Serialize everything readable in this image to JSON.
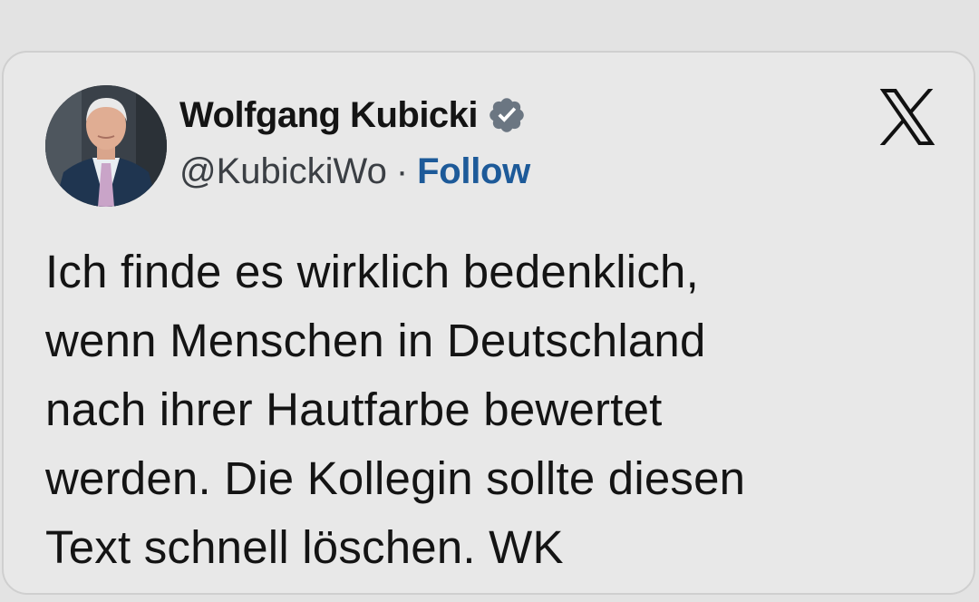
{
  "tweet": {
    "author": {
      "display_name": "Wolfgang Kubicki",
      "handle": "@KubickiWo",
      "separator": "·",
      "verified_badge_icon": "verified-badge-icon",
      "avatar_icon": "avatar-photo"
    },
    "follow_label": "Follow",
    "platform_logo": "x-logo-icon",
    "text_lines": [
      "Ich finde es wirklich bedenklich,",
      "wenn Menschen in Deutschland",
      "nach ihrer Hautfarbe bewertet",
      "werden. Die Kollegin sollte diesen",
      "Text schnell löschen. WK"
    ]
  },
  "colors": {
    "background": "#e3e3e3",
    "card": "#e8e8e8",
    "text": "#141414",
    "handle": "#3b3f44",
    "follow": "#1d5a99",
    "badge": "#6b7682"
  }
}
